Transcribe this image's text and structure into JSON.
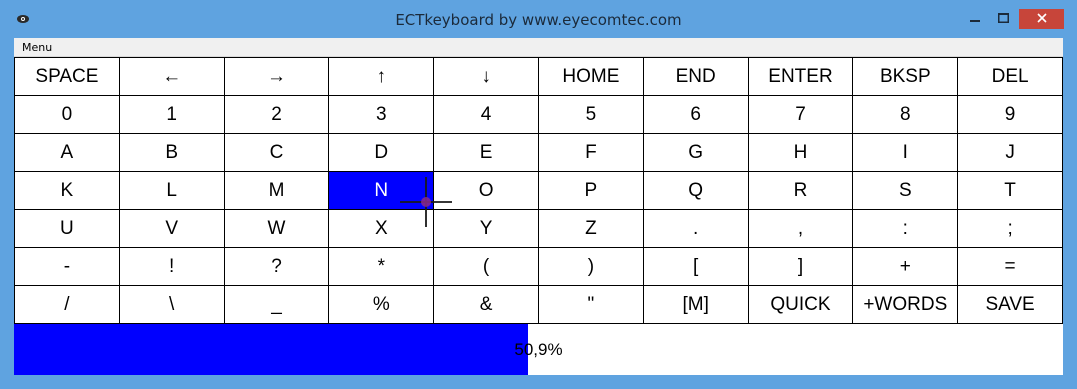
{
  "window": {
    "title": "ECTkeyboard by www.eyecomtec.com",
    "icon": "app-icon",
    "controls": [
      "minimize-icon",
      "maximize-icon",
      "close-icon"
    ],
    "accent_color": "#5fa3e0",
    "close_color": "#c7453a"
  },
  "menubar": {
    "items": [
      "Menu"
    ]
  },
  "keyboard": {
    "selected_color": "#0000ff",
    "rows": [
      [
        "SPACE",
        "←",
        "→",
        "↑",
        "↓",
        "HOME",
        "END",
        "ENTER",
        "BKSP",
        "DEL"
      ],
      [
        "0",
        "1",
        "2",
        "3",
        "4",
        "5",
        "6",
        "7",
        "8",
        "9"
      ],
      [
        "A",
        "B",
        "C",
        "D",
        "E",
        "F",
        "G",
        "H",
        "I",
        "J"
      ],
      [
        "K",
        "L",
        "M",
        "N",
        "O",
        "P",
        "Q",
        "R",
        "S",
        "T"
      ],
      [
        "U",
        "V",
        "W",
        "X",
        "Y",
        "Z",
        ".",
        ",",
        ":",
        ";"
      ],
      [
        "-",
        "!",
        "?",
        "*",
        "(",
        ")",
        "[",
        "]",
        "+",
        "="
      ],
      [
        "/",
        "\\",
        "_",
        "%",
        "&",
        "\"",
        "[M]",
        "QUICK",
        "+WORDS",
        "SAVE"
      ]
    ],
    "selected_key": "N"
  },
  "progress": {
    "label": "50,9%",
    "value": 0.49,
    "fill_color": "#0000ff"
  }
}
